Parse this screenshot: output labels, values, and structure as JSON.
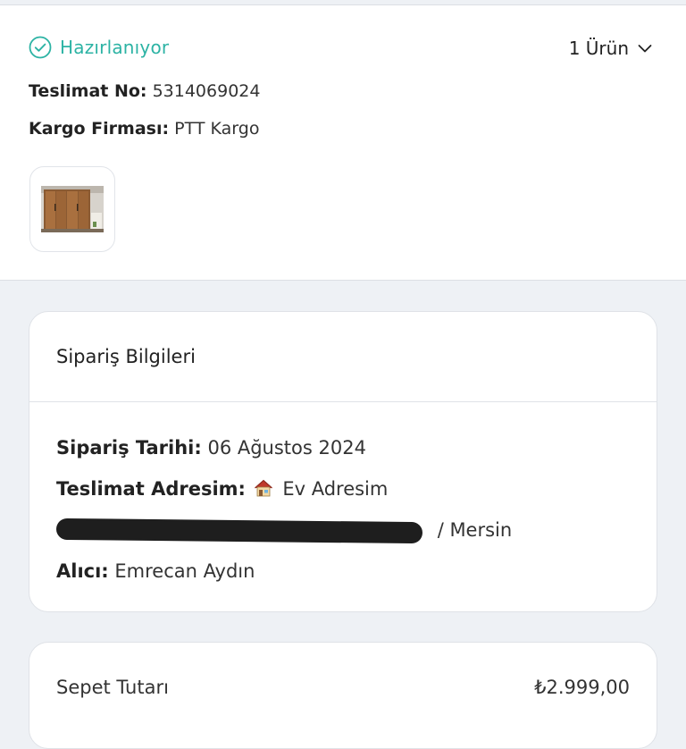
{
  "shipment": {
    "status": "Hazırlanıyor",
    "status_icon": "check-circle-icon",
    "status_color": "#2cb3a4",
    "items_toggle": "1 Ürün",
    "tracking_label": "Teslimat No:",
    "tracking_value": "5314069024",
    "carrier_label": "Kargo Firması:",
    "carrier_value": "PTT Kargo"
  },
  "order_info": {
    "title": "Sipariş Bilgileri",
    "date_label": "Sipariş Tarihi:",
    "date_value": "06 Ağustos 2024",
    "address_label": "Teslimat Adresim:",
    "address_name": "Ev Adresim",
    "address_city": "/ Mersin",
    "recipient_label": "Alıcı:",
    "recipient_value": "Emrecan Aydın"
  },
  "summary": {
    "label": "Sepet Tutarı",
    "value": "₺2.999,00"
  }
}
